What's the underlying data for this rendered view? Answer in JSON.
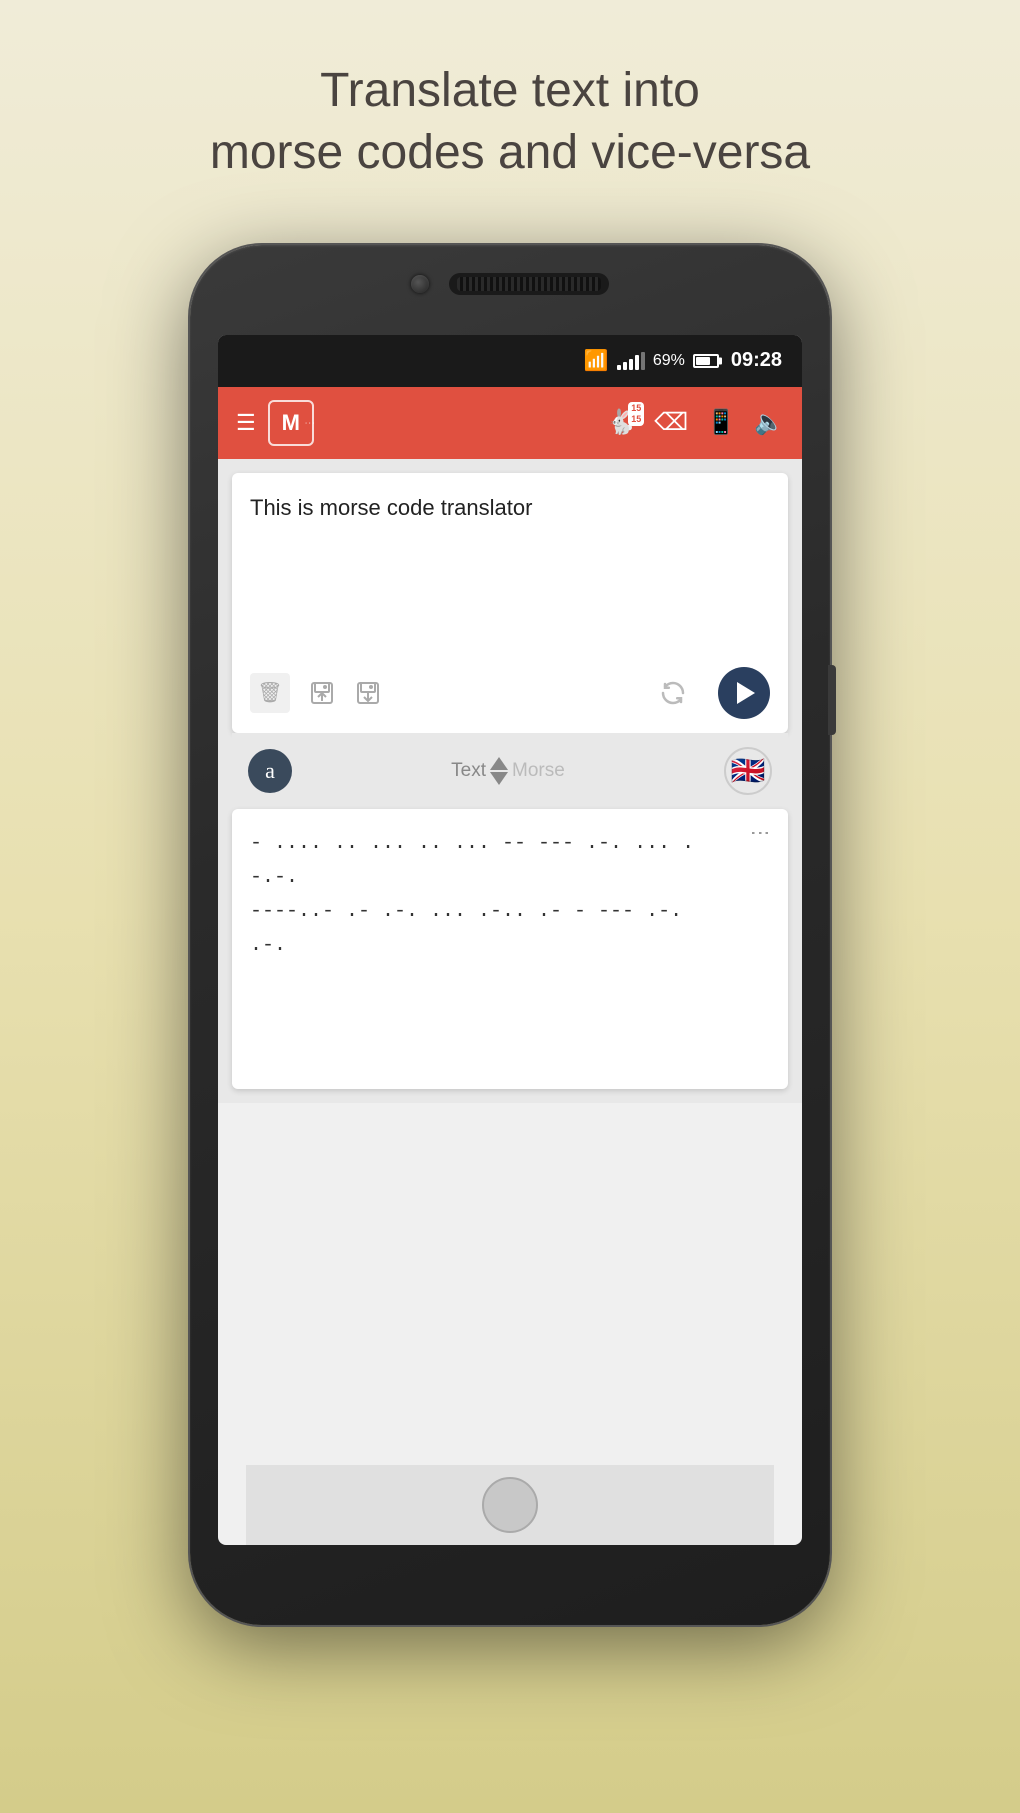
{
  "page": {
    "headline_line1": "Translate text into",
    "headline_line2": "morse codes and vice-versa"
  },
  "status_bar": {
    "battery_pct": "69%",
    "time": "09:28"
  },
  "toolbar": {
    "app_letter": "M",
    "notification_count_1": "15",
    "notification_count_2": "15"
  },
  "input_card": {
    "text": "This is morse code translator"
  },
  "mode_row": {
    "avatar_letter": "a",
    "text_label": "Text",
    "morse_label": "Morse"
  },
  "output_card": {
    "morse_line1": "- .... .. ... .. ... -- --- .-. ... . -.-.",
    "morse_line2": "----..- .- .-. ... .-.. .- - --- .-.",
    "morse_line3": ".-."
  },
  "icons": {
    "delete": "🗑",
    "save_up": "💾",
    "save_down": "💾",
    "wifi": "⊛",
    "hamburger": "☰"
  }
}
